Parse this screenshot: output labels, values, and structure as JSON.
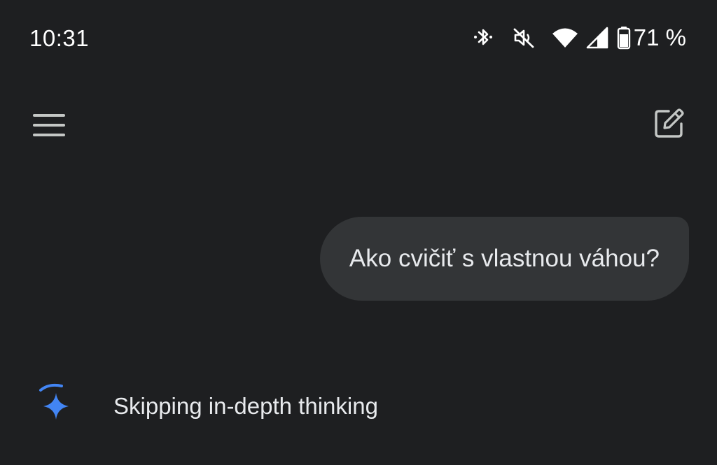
{
  "status_bar": {
    "time": "10:31",
    "battery_percent": "71 %",
    "icons": [
      "bluetooth-icon",
      "vibrate-mute-icon",
      "wifi-icon",
      "cell-signal-icon",
      "battery-icon"
    ]
  },
  "app_bar": {
    "menu_icon": "hamburger-menu-icon",
    "new_chat_icon": "edit-pencil-icon"
  },
  "chat": {
    "user_message": "Ako cvičiť s vlastnou váhou?",
    "status_text": "Skipping in-depth thinking"
  },
  "colors": {
    "background": "#1e1f21",
    "bubble": "#333537",
    "text": "#e8eaed",
    "accent_blue": "#4285f4"
  }
}
